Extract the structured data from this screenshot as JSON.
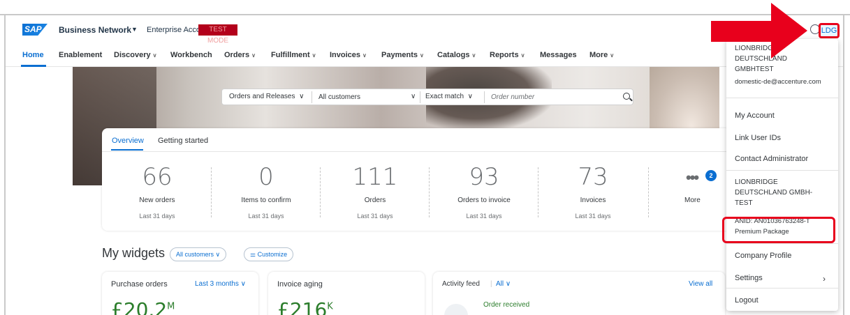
{
  "shell": {
    "logo": "SAP",
    "product": "Business Network",
    "account_type": "Enterprise Account",
    "badge": "TEST MODE",
    "avatar": "LDG"
  },
  "nav": {
    "items": [
      {
        "label": "Home"
      },
      {
        "label": "Enablement"
      },
      {
        "label": "Discovery"
      },
      {
        "label": "Workbench"
      },
      {
        "label": "Orders"
      },
      {
        "label": "Fulfillment"
      },
      {
        "label": "Invoices"
      },
      {
        "label": "Payments"
      },
      {
        "label": "Catalogs"
      },
      {
        "label": "Reports"
      },
      {
        "label": "Messages"
      },
      {
        "label": "More"
      }
    ]
  },
  "search": {
    "type": "Orders and Releases",
    "customers": "All customers",
    "match": "Exact match",
    "placeholder": "Order number"
  },
  "overview": {
    "tabs": [
      "Overview",
      "Getting started"
    ],
    "tiles": [
      {
        "value": "66",
        "label": "New orders",
        "period": "Last 31 days"
      },
      {
        "value": "0",
        "label": "Items to confirm",
        "period": "Last 31 days"
      },
      {
        "value": "111",
        "label": "Orders",
        "period": "Last 31 days"
      },
      {
        "value": "93",
        "label": "Orders to invoice",
        "period": "Last 31 days"
      },
      {
        "value": "73",
        "label": "Invoices",
        "period": "Last 31 days"
      }
    ],
    "more_label": "More",
    "more_count": "2"
  },
  "widgets": {
    "title": "My widgets",
    "filter": "All customers",
    "customize": "Customize",
    "purchase_orders": {
      "title": "Purchase orders",
      "range": "Last 3 months",
      "value": "£20.2",
      "unit": "M"
    },
    "invoice_aging": {
      "title": "Invoice aging",
      "value": "£216",
      "unit": "K"
    },
    "activity_feed": {
      "title": "Activity feed",
      "filter": "All",
      "view_all": "View all",
      "item": "Order received"
    }
  },
  "menu": {
    "company_top": [
      "LIONBRIDGE",
      "DEUTSCHLAND",
      "GMBHTEST"
    ],
    "email": "domestic-de@accenture.com",
    "my_account": "My Account",
    "link_user_ids": "Link User IDs",
    "contact_admin": "Contact Administrator",
    "company_bottom": [
      "LIONBRIDGE",
      "DEUTSCHLAND GMBH-",
      "TEST"
    ],
    "anid": "ANID: AN01036763248-T",
    "package": "Premium Package",
    "company_profile": "Company Profile",
    "settings": "Settings",
    "logout": "Logout"
  },
  "colors": {
    "accent": "#0a6ed1",
    "highlight": "#e8001c",
    "positive": "#2b7d2b"
  }
}
